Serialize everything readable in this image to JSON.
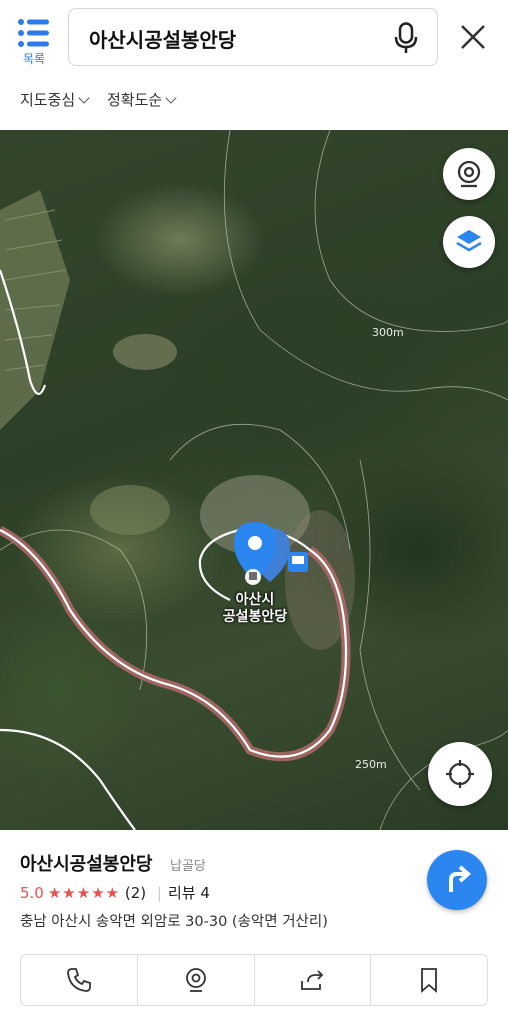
{
  "header": {
    "list_label": "목록",
    "search_query": "아산시공설봉안당",
    "filters": [
      {
        "label": "지도중심"
      },
      {
        "label": "정확도순"
      }
    ]
  },
  "map": {
    "contour_labels": [
      "300m",
      "250m"
    ],
    "place_name_line1": "아산시",
    "place_name_line2": "공설봉안당"
  },
  "place": {
    "name": "아산시공설봉안당",
    "category": "납골당",
    "rating": "5.0",
    "stars": "★★★★★",
    "rating_count": "(2)",
    "separator": "|",
    "reviews": "리뷰 4",
    "address": "충남 아산시 송악면 외암로 30-30 (송악면 거산리)"
  },
  "colors": {
    "accent": "#2b86f0",
    "rating": "#e8524e"
  }
}
